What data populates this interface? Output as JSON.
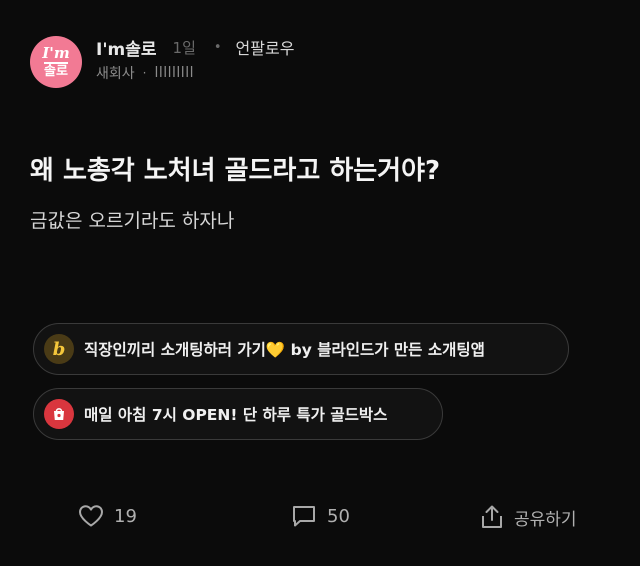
{
  "author": {
    "avatar_line1": "I'm",
    "avatar_line2": "솔로",
    "name": "I'm솔로",
    "time": "1일",
    "follow_label": "언팔로우",
    "company": "새회사",
    "masked_info": "lllllllll"
  },
  "post": {
    "title": "왜 노총각 노처녀 골드라고 하는거야?",
    "body": "금값은 오르기라도 하자나"
  },
  "ads": [
    {
      "icon": "blind-logo-icon",
      "icon_text": "b",
      "text": "직장인끼리 소개팅하러 가기💛 by 블라인드가 만든 소개팅앱"
    },
    {
      "icon": "shopping-bag-icon",
      "text": "매일 아침 7시 OPEN! 단 하루 특가 골드박스"
    }
  ],
  "actions": {
    "likes": "19",
    "comments": "50",
    "share_label": "공유하기"
  },
  "colors": {
    "background": "#0b0b0b",
    "avatar": "#f27a94",
    "blind_icon_bg": "#4a3b16",
    "blind_icon_fg": "#f5c73b",
    "coupang_icon_bg": "#d9363e"
  }
}
